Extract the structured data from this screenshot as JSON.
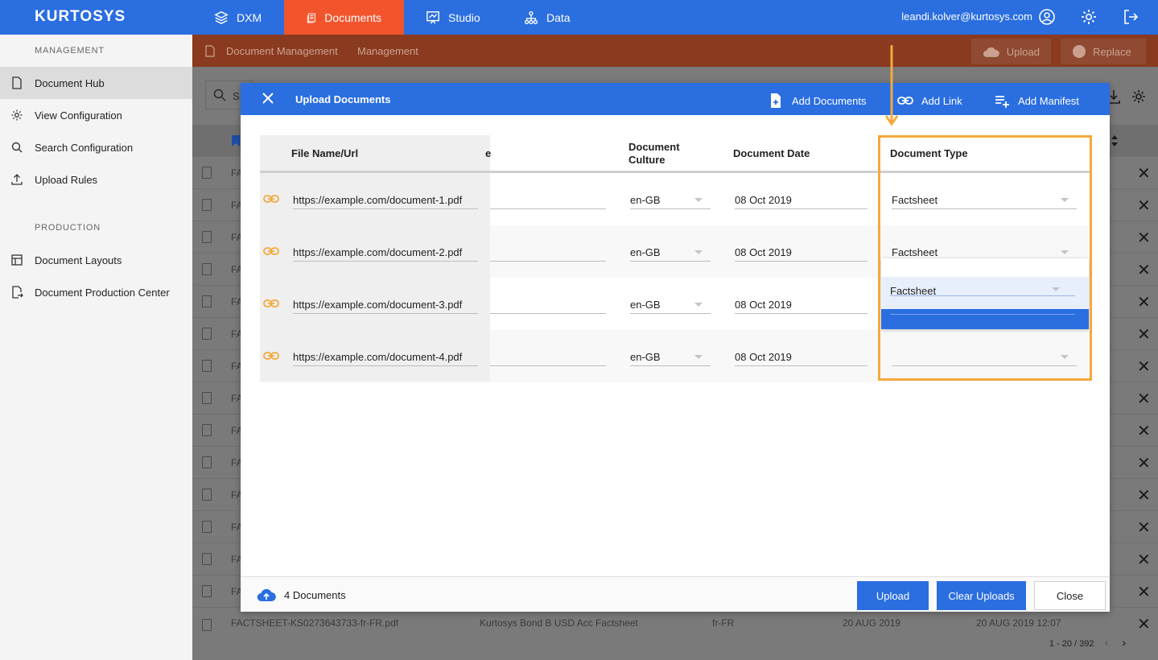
{
  "app": {
    "logo": "KURTOSYS",
    "nav": [
      {
        "label": "DXM",
        "icon": "layers-icon"
      },
      {
        "label": "Documents",
        "icon": "documents-icon"
      },
      {
        "label": "Studio",
        "icon": "studio-icon"
      },
      {
        "label": "Data",
        "icon": "sitemap-icon"
      }
    ],
    "user_email": "leandi.kolver@kurtosys.com",
    "accent_color": "#2a6ee0",
    "active_tab_color": "#f2552c"
  },
  "sidebar": {
    "management_label": "MANAGEMENT",
    "production_label": "PRODUCTION",
    "items": [
      {
        "label": "Document Hub",
        "icon": "document-icon"
      },
      {
        "label": "View Configuration",
        "icon": "gear-icon"
      },
      {
        "label": "Search Configuration",
        "icon": "search-icon"
      },
      {
        "label": "Upload Rules",
        "icon": "upload-icon"
      },
      {
        "label": "Document Layouts",
        "icon": "layout-icon"
      },
      {
        "label": "Document Production Center",
        "icon": "document-export-icon"
      }
    ]
  },
  "background": {
    "breadcrumb": [
      "Document Management",
      "Management"
    ],
    "upload_label": "Upload",
    "replace_label": "Replace",
    "row_prefix": "FA",
    "last_row": {
      "file": "FACTSHEET-KS0273643733-fr-FR.pdf",
      "title": "Kurtosys Bond B USD Acc Factsheet",
      "culture": "fr-FR",
      "date": "20 AUG 2019",
      "modified": "20 AUG 2019 12:07"
    },
    "pager": "1 - 20 / 392"
  },
  "modal": {
    "title": "Upload Documents",
    "actions": {
      "add_documents": "Add Documents",
      "add_link": "Add Link",
      "add_manifest": "Add Manifest"
    },
    "columns": {
      "file": "File Name/Url",
      "title_tail": "e",
      "culture": "Document Culture",
      "date": "Document Date",
      "type": "Document Type"
    },
    "rows": [
      {
        "url": "https://example.com/document-1.pdf",
        "culture": "en-GB",
        "date": "08 Oct 2019",
        "type": "Factsheet"
      },
      {
        "url": "https://example.com/document-2.pdf",
        "culture": "en-GB",
        "date": "08 Oct 2019",
        "type": "Factsheet"
      },
      {
        "url": "https://example.com/document-3.pdf",
        "culture": "en-GB",
        "date": "08 Oct 2019",
        "type": ""
      },
      {
        "url": "https://example.com/document-4.pdf",
        "culture": "en-GB",
        "date": "08 Oct 2019",
        "type": ""
      }
    ],
    "dropdown_option": "Factsheet",
    "footer": {
      "count": "4 Documents",
      "upload": "Upload",
      "clear": "Clear Uploads",
      "close": "Close"
    },
    "highlight_color": "#f4a93b"
  }
}
